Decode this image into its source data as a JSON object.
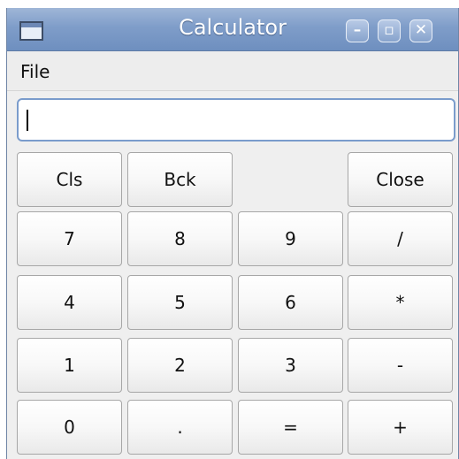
{
  "window": {
    "title": "Calculator"
  },
  "menu": {
    "file": "File"
  },
  "display": {
    "value": ""
  },
  "keys": {
    "cls": "Cls",
    "bck": "Bck",
    "close": "Close",
    "k7": "7",
    "k8": "8",
    "k9": "9",
    "div": "/",
    "k4": "4",
    "k5": "5",
    "k6": "6",
    "mul": "*",
    "k1": "1",
    "k2": "2",
    "k3": "3",
    "sub": "-",
    "k0": "0",
    "dot": ".",
    "eq": "=",
    "add": "+"
  },
  "window_controls": {
    "minimize": "–",
    "maximize": "▫",
    "close": "✕"
  }
}
